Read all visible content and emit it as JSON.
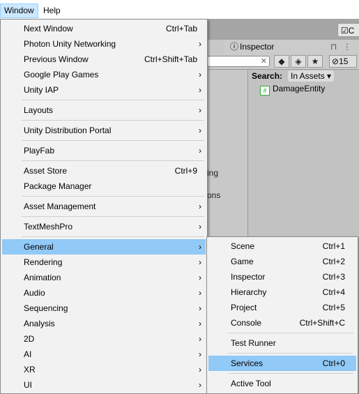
{
  "menubar": {
    "window": "Window",
    "help": "Help"
  },
  "editor": {
    "collab_label": "C",
    "inspector_tab": "Inspector",
    "hidden_count": "15",
    "search_label": "Search:",
    "search_scope": "In Assets",
    "result": "DamageEntity",
    "partial_text_1": "ing",
    "partial_text_2": "ons"
  },
  "window_menu": {
    "items": [
      {
        "label": "Next Window",
        "shortcut": "Ctrl+Tab"
      },
      {
        "label": "Photon Unity Networking",
        "arrow": "›"
      },
      {
        "label": "Previous Window",
        "shortcut": "Ctrl+Shift+Tab"
      },
      {
        "label": "Google Play Games",
        "arrow": "›"
      },
      {
        "label": "Unity IAP",
        "arrow": "›"
      },
      {
        "label": "Layouts",
        "arrow": "›"
      },
      {
        "label": "Unity Distribution Portal",
        "arrow": "›"
      },
      {
        "label": "PlayFab",
        "arrow": "›"
      },
      {
        "label": "Asset Store",
        "shortcut": "Ctrl+9"
      },
      {
        "label": "Package Manager"
      },
      {
        "label": "Asset Management",
        "arrow": "›"
      },
      {
        "label": "TextMeshPro",
        "arrow": "›"
      },
      {
        "label": "General",
        "arrow": "›"
      },
      {
        "label": "Rendering",
        "arrow": "›"
      },
      {
        "label": "Animation",
        "arrow": "›"
      },
      {
        "label": "Audio",
        "arrow": "›"
      },
      {
        "label": "Sequencing",
        "arrow": "›"
      },
      {
        "label": "Analysis",
        "arrow": "›"
      },
      {
        "label": "2D",
        "arrow": "›"
      },
      {
        "label": "AI",
        "arrow": "›"
      },
      {
        "label": "XR",
        "arrow": "›"
      },
      {
        "label": "UI",
        "arrow": "›"
      }
    ]
  },
  "general_submenu": {
    "items": [
      {
        "label": "Scene",
        "shortcut": "Ctrl+1"
      },
      {
        "label": "Game",
        "shortcut": "Ctrl+2"
      },
      {
        "label": "Inspector",
        "shortcut": "Ctrl+3"
      },
      {
        "label": "Hierarchy",
        "shortcut": "Ctrl+4"
      },
      {
        "label": "Project",
        "shortcut": "Ctrl+5"
      },
      {
        "label": "Console",
        "shortcut": "Ctrl+Shift+C"
      },
      {
        "label": "Test Runner"
      },
      {
        "label": "Services",
        "shortcut": "Ctrl+0"
      },
      {
        "label": "Active Tool"
      }
    ]
  },
  "colors": {
    "highlight": "#91c9f7",
    "menu_bg": "#f2f2f2",
    "menubar_active": "#cce8ff"
  }
}
